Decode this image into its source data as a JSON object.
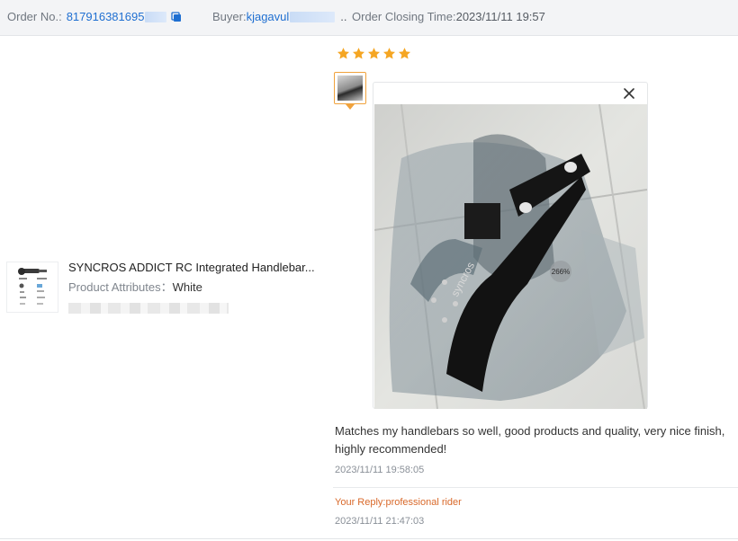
{
  "header": {
    "order_label": "Order No.:",
    "order_value": "817916381695",
    "buyer_label": "Buyer:",
    "buyer_value": "kjagavul",
    "buyer_ellipsis": "..",
    "closing_label": "Order Closing Time:",
    "closing_value": "2023/11/11 19:57"
  },
  "product": {
    "title": "SYNCROS ADDICT RC Integrated Handlebar...",
    "attr_label": "Product Attributes：",
    "attr_value": "White"
  },
  "rating": {
    "stars": 5,
    "max": 5,
    "color": "#f5a623"
  },
  "preview": {
    "zoom_label": "266%",
    "brand_text": "syncros"
  },
  "review": {
    "text": "Matches my handlebars so well, good products and quality, very nice finish, highly recommended!",
    "date": "2023/11/11 19:58:05"
  },
  "reply": {
    "text": "Your Reply:professional rider",
    "date": "2023/11/11 21:47:03"
  },
  "colors": {
    "link": "#1f6fd1",
    "accent": "#f0a23c",
    "reply": "#d9692a"
  },
  "icons": [
    "copy-icon",
    "star-icon",
    "close-icon"
  ]
}
